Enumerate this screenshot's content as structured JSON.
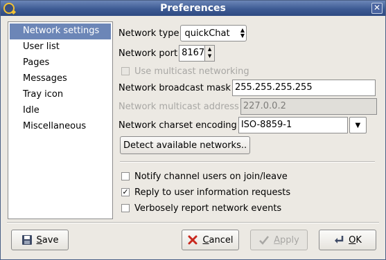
{
  "window": {
    "title": "Preferences"
  },
  "sidebar": {
    "items": [
      {
        "label": "Network settings",
        "selected": true
      },
      {
        "label": "User list"
      },
      {
        "label": "Pages"
      },
      {
        "label": "Messages"
      },
      {
        "label": "Tray icon"
      },
      {
        "label": "Idle"
      },
      {
        "label": "Miscellaneous"
      }
    ]
  },
  "network": {
    "type_label": "Network type",
    "type_value": "quickChat",
    "port_label": "Network port",
    "port_value": "8167",
    "multicast_label": "Use multicast networking",
    "broadcast_label": "Network broadcast mask",
    "broadcast_value": "255.255.255.255",
    "multicast_addr_label": "Network multicast address",
    "multicast_addr_value": "227.0.0.2",
    "charset_label": "Network charset encoding",
    "charset_value": "ISO-8859-1",
    "detect_label": "Detect available networks.."
  },
  "options": [
    {
      "label": "Notify channel users on join/leave",
      "checked": false
    },
    {
      "label": "Reply to user information requests",
      "checked": true
    },
    {
      "label": "Verbosely report network events",
      "checked": false
    }
  ],
  "buttons": {
    "save": {
      "first": "S",
      "rest": "ave"
    },
    "cancel": {
      "first": "C",
      "rest": "ancel"
    },
    "apply": {
      "first": "A",
      "rest": "pply"
    },
    "ok": {
      "first": "O",
      "rest": "K"
    }
  }
}
